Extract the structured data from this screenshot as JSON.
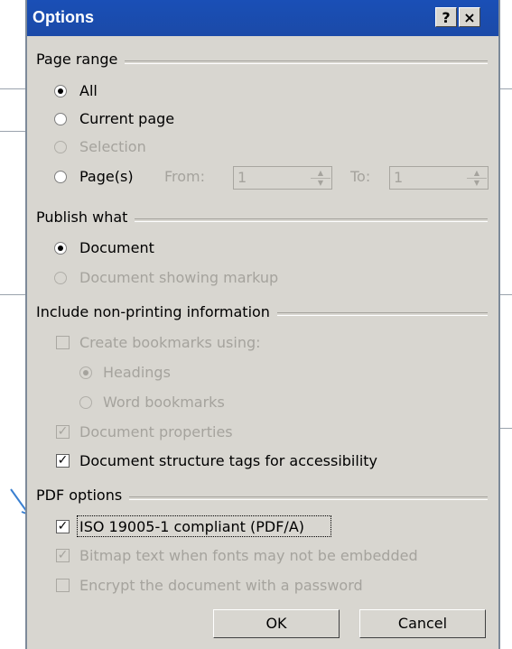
{
  "dialog": {
    "title": "Options",
    "help_button": "?",
    "close_button": "×"
  },
  "page_range": {
    "label": "Page range",
    "all": "All",
    "current_page": "Current page",
    "selection": "Selection",
    "pages": "Page(s)",
    "from_label": "From:",
    "from_value": "1",
    "to_label": "To:",
    "to_value": "1"
  },
  "publish_what": {
    "label": "Publish what",
    "document": "Document",
    "document_markup": "Document showing markup"
  },
  "non_printing": {
    "label": "Include non-printing information",
    "create_bookmarks": "Create bookmarks using:",
    "headings": "Headings",
    "word_bookmarks": "Word bookmarks",
    "document_properties": "Document properties",
    "structure_tags": "Document structure tags for accessibility"
  },
  "pdf_options": {
    "label": "PDF options",
    "iso": "ISO 19005-1 compliant (PDF/A)",
    "bitmap_text": "Bitmap text when fonts may not be embedded",
    "encrypt": "Encrypt the document with a password"
  },
  "buttons": {
    "ok": "OK",
    "cancel": "Cancel"
  },
  "colors": {
    "titlebar": "#1a4fb6",
    "dialog_bg": "#d8d6d0",
    "disabled_text": "#a5a39d"
  }
}
